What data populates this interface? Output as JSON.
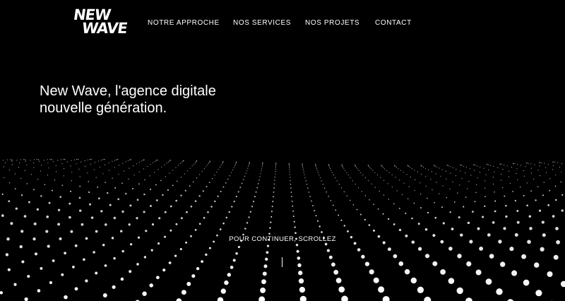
{
  "brand": {
    "logo_line1": "NEW",
    "logo_line2": "WAVE"
  },
  "nav": {
    "items": [
      {
        "label": "NOTRE APPROCHE"
      },
      {
        "label": "NOS SERVICES"
      },
      {
        "label": "NOS PROJETS"
      },
      {
        "label": "CONTACT"
      }
    ]
  },
  "hero": {
    "headline_line1": "New Wave, l'agence digitale",
    "headline_line2": "nouvelle génération."
  },
  "scroll": {
    "label": "POUR CONTINUER, SCROLLEZ"
  },
  "colors": {
    "background": "#000000",
    "foreground": "#ffffff"
  }
}
